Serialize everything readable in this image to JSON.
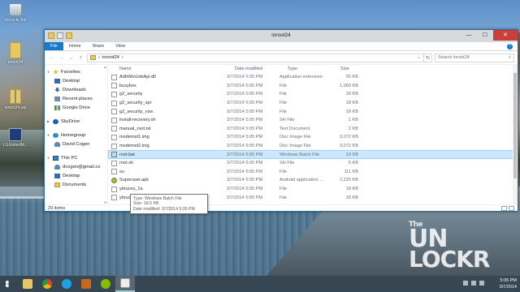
{
  "desktop": {
    "icons": [
      {
        "label": "Recycle Bin",
        "glyph": "recycle-bin"
      },
      {
        "label": "ioroot24",
        "glyph": "folder"
      },
      {
        "label": "ioroot24.zip",
        "glyph": "zip"
      },
      {
        "label": "LGUnitedM...",
        "glyph": "app"
      }
    ],
    "watermark": {
      "line1": "The",
      "line2": "UN",
      "line3": "LOCKR"
    }
  },
  "window": {
    "title": "ioroot24",
    "controls": {
      "minimize": "—",
      "maximize": "☐",
      "close": "✕"
    },
    "ribbon_tabs": [
      "File",
      "Home",
      "Share",
      "View"
    ],
    "help": "?",
    "nav_buttons": {
      "back": "←",
      "forward": "→",
      "dropdown": "⌄",
      "up": "↑"
    },
    "address": {
      "separator": "›",
      "path": "ioroot24",
      "dropdown": "⌄",
      "refresh": "↻"
    },
    "search": {
      "placeholder": "Search ioroot24",
      "icon": "⌕"
    },
    "nav_pane": {
      "groups": [
        {
          "label": "Favorites",
          "icon": "star-icon",
          "items": [
            {
              "label": "Desktop",
              "icon": "desktop-icon"
            },
            {
              "label": "Downloads",
              "icon": "downloads-icon"
            },
            {
              "label": "Recent places",
              "icon": "recent-places-icon"
            },
            {
              "label": "Google Drive",
              "icon": "google-drive-icon"
            }
          ]
        },
        {
          "label": "SkyDrive",
          "icon": "skydrive-icon",
          "items": []
        },
        {
          "label": "Homegroup",
          "icon": "homegroup-icon",
          "items": [
            {
              "label": "David Cogen",
              "icon": "user-icon"
            }
          ]
        },
        {
          "label": "This PC",
          "icon": "this-pc-icon",
          "items": [
            {
              "label": "dcogen@gmail.co",
              "icon": "user-icon"
            },
            {
              "label": "Desktop",
              "icon": "desktop-icon"
            },
            {
              "label": "Documents",
              "icon": "documents-icon"
            }
          ]
        }
      ]
    },
    "columns": {
      "name": "Name",
      "date": "Date modified",
      "type": "Type",
      "size": "Size",
      "sort_glyph": "^"
    },
    "files": [
      {
        "name": "AdbWinUsbApi.dll",
        "date": "3/7/2014 5:05 PM",
        "type": "Application extension",
        "size": "95 KB",
        "icon": "file"
      },
      {
        "name": "busybox",
        "date": "3/7/2014 5:05 PM",
        "type": "File",
        "size": "1,060 KB",
        "icon": "file"
      },
      {
        "name": "g2_security",
        "date": "3/7/2014 5:05 PM",
        "type": "File",
        "size": "18 KB",
        "icon": "file"
      },
      {
        "name": "g2_security_spr",
        "date": "3/7/2014 5:05 PM",
        "type": "File",
        "size": "18 KB",
        "icon": "file"
      },
      {
        "name": "g2_security_vzw",
        "date": "3/7/2014 5:05 PM",
        "type": "File",
        "size": "18 KB",
        "icon": "file"
      },
      {
        "name": "install-recovery.sh",
        "date": "3/7/2014 5:05 PM",
        "type": "SH File",
        "size": "1 KB",
        "icon": "file"
      },
      {
        "name": "manual_root.txt",
        "date": "3/7/2014 5:05 PM",
        "type": "Text Document",
        "size": "2 KB",
        "icon": "file"
      },
      {
        "name": "modemst1.img",
        "date": "3/7/2014 5:05 PM",
        "type": "Disc Image File",
        "size": "3,072 KB",
        "icon": "file"
      },
      {
        "name": "modemst2.img",
        "date": "3/7/2014 5:05 PM",
        "type": "Disc Image File",
        "size": "3,072 KB",
        "icon": "file"
      },
      {
        "name": "root.bat",
        "date": "3/7/2014 5:05 PM",
        "type": "Windows Batch File",
        "size": "19 KB",
        "icon": "bat"
      },
      {
        "name": "root.sh",
        "date": "3/7/2014 5:05 PM",
        "type": "SH File",
        "size": "5 KB",
        "icon": "file"
      },
      {
        "name": "su",
        "date": "3/7/2014 5:05 PM",
        "type": "File",
        "size": "111 KB",
        "icon": "file"
      },
      {
        "name": "Superuser.apk",
        "date": "3/7/2014 5:05 PM",
        "type": "Android application ...",
        "size": "2,225 KB",
        "icon": "apk"
      },
      {
        "name": "ytiruces_1a",
        "date": "3/7/2014 5:05 PM",
        "type": "File",
        "size": "18 KB",
        "icon": "file"
      },
      {
        "name": "ytiruces_1a_att",
        "date": "3/7/2014 5:05 PM",
        "type": "File",
        "size": "18 KB",
        "icon": "file"
      }
    ],
    "selected_row_index": 9,
    "tooltip": {
      "line1": "Type: Windows Batch File",
      "line2": "Size: 18.5 KB",
      "line3": "Date modified: 3/7/2014 5:05 PM"
    },
    "status": {
      "count": "29 items"
    }
  },
  "taskbar": {
    "apps": [
      "file-explorer",
      "chrome",
      "internet-explorer",
      "app-a",
      "spotify",
      "active-window"
    ],
    "clock": {
      "time": "5:05 PM",
      "date": "3/7/2014"
    }
  }
}
